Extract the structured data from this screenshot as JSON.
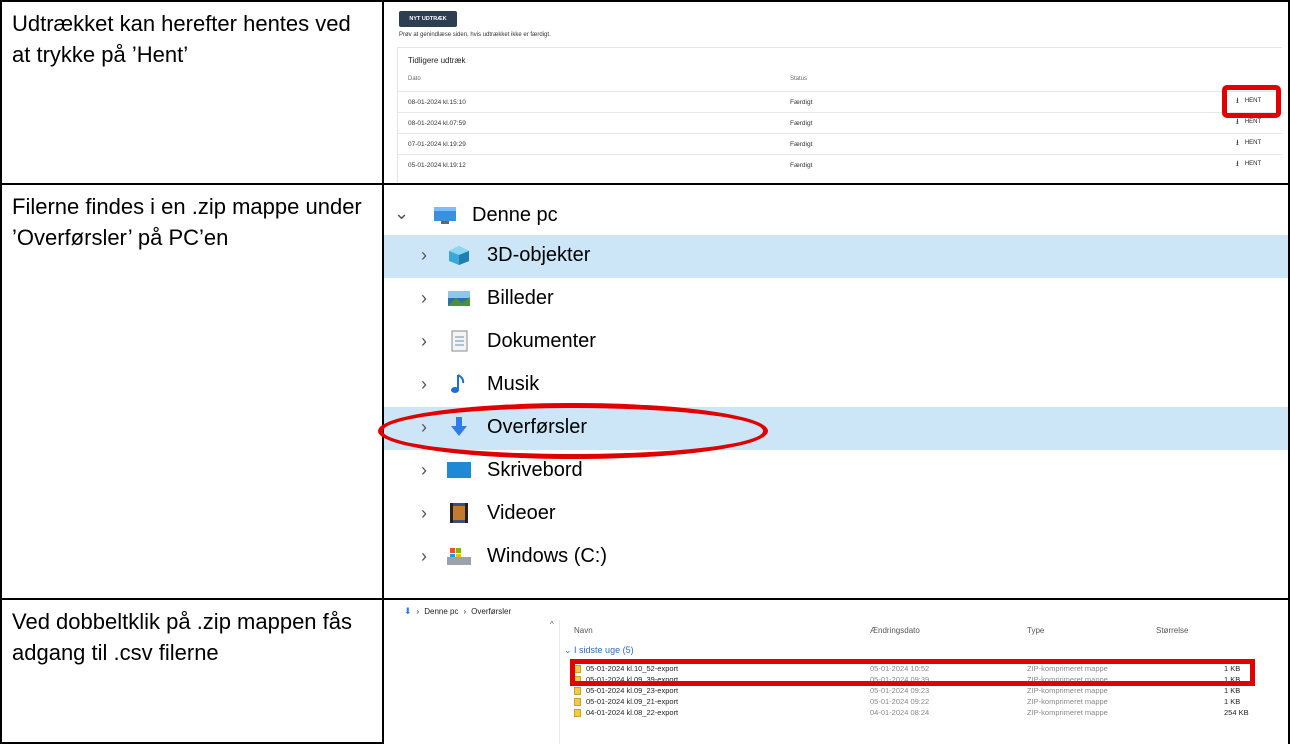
{
  "instructions": [
    "Udtrækket kan herefter hentes ved at trykke på ’Hent’",
    "Filerne findes i en .zip mappe under ’Overførsler’ på PC’en",
    "Ved dobbeltklik på .zip mappen fås adgang til .csv filerne"
  ],
  "export_app": {
    "new_button": "NYT UDTRÆK",
    "hint": "Prøv at genindlæse siden, hvis udtrækket ikke er færdigt.",
    "panel_title": "Tidligere udtræk",
    "columns": {
      "date": "Dato",
      "status": "Status"
    },
    "download_label": "HENT",
    "rows": [
      {
        "date": "08-01-2024 kl.15:10",
        "status": "Færdigt"
      },
      {
        "date": "08-01-2024 kl.07:59",
        "status": "Færdigt"
      },
      {
        "date": "07-01-2024 kl.19:29",
        "status": "Færdigt"
      },
      {
        "date": "05-01-2024 kl.19:12",
        "status": "Færdigt"
      }
    ]
  },
  "explorer_tree": {
    "root": "Denne pc",
    "items": [
      {
        "label": "3D-objekter",
        "icon": "cube-3d-icon",
        "selected": true
      },
      {
        "label": "Billeder",
        "icon": "pictures-icon",
        "selected": false
      },
      {
        "label": "Dokumenter",
        "icon": "document-icon",
        "selected": false
      },
      {
        "label": "Musik",
        "icon": "music-note-icon",
        "selected": false
      },
      {
        "label": "Overførsler",
        "icon": "download-arrow-icon",
        "selected": true
      },
      {
        "label": "Skrivebord",
        "icon": "desktop-icon",
        "selected": false
      },
      {
        "label": "Videoer",
        "icon": "video-icon",
        "selected": false
      },
      {
        "label": "Windows (C:)",
        "icon": "drive-icon",
        "selected": false
      }
    ]
  },
  "file_list": {
    "breadcrumb": [
      "Denne pc",
      "Overførsler"
    ],
    "columns": {
      "name": "Navn",
      "modified": "Ændringsdato",
      "type": "Type",
      "size": "Størrelse"
    },
    "group": "I sidste uge (5)",
    "files": [
      {
        "name": "05-01-2024 kl.10_52-export",
        "modified": "05-01-2024 10:52",
        "type": "ZIP-komprimeret mappe",
        "size": "1 KB"
      },
      {
        "name": "05-01-2024 kl.09_39-export",
        "modified": "05-01-2024 09:39",
        "type": "ZIP-komprimeret mappe",
        "size": "1 KB"
      },
      {
        "name": "05-01-2024 kl.09_23-export",
        "modified": "05-01-2024 09:23",
        "type": "ZIP-komprimeret mappe",
        "size": "1 KB"
      },
      {
        "name": "05-01-2024 kl.09_21-export",
        "modified": "05-01-2024 09:22",
        "type": "ZIP-komprimeret mappe",
        "size": "1 KB"
      },
      {
        "name": "04-01-2024 kl.08_22-export",
        "modified": "04-01-2024 08:24",
        "type": "ZIP-komprimeret mappe",
        "size": "254 KB"
      }
    ]
  },
  "colors": {
    "highlight_red": "#e00000",
    "selection_blue": "#cce6f8",
    "button_dark": "#2e3e52"
  }
}
